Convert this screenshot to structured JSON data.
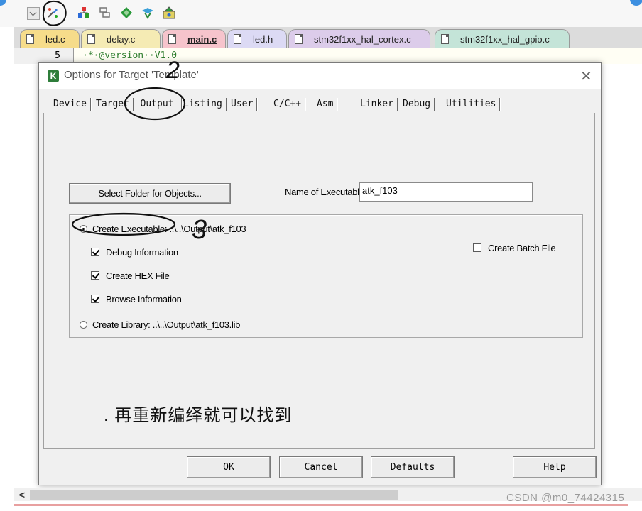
{
  "toolbar": {
    "icons": [
      "dropdown-arrow-icon",
      "options-for-target-icon",
      "manage-components-icon",
      "file-extensions-icon",
      "pack-installer-icon",
      "select-device-icon",
      "manage-packs-icon"
    ]
  },
  "editor_tabs": [
    {
      "label": "led.c",
      "color": "#f6dc8a"
    },
    {
      "label": "delay.c",
      "color": "#f5ebb4"
    },
    {
      "label": "main.c",
      "color": "#f6c4cc",
      "active": true
    },
    {
      "label": "led.h",
      "color": "#dcdaf4"
    },
    {
      "label": "stm32f1xx_hal_cortex.c",
      "color": "#dcccea"
    },
    {
      "label": "stm32f1xx_hal_gpio.c",
      "color": "#c4e4d8"
    }
  ],
  "code": {
    "line_number": "5",
    "text": "·*·@version··V1.0"
  },
  "dialog": {
    "title": "Options for Target 'Template'",
    "tabs": [
      "Device",
      "Target",
      "Output",
      "Listing",
      "User",
      "C/C++",
      "Asm",
      "Linker",
      "Debug",
      "Utilities"
    ],
    "active_tab": "Output",
    "select_folder_label": "Select Folder for Objects...",
    "name_of_executable_label": "Name of Executable:",
    "name_of_executable_value": "atk_f103",
    "create_executable_label": "Create Executable:  ..\\..\\Output\\atk_f103",
    "debug_information_label": "Debug Information",
    "create_hex_file_label": "Create HEX File",
    "browse_information_label": "Browse Information",
    "create_batch_file_label": "Create Batch File",
    "create_library_label": "Create Library:  ..\\..\\Output\\atk_f103.lib",
    "options": {
      "create_executable_selected": true,
      "debug_information_checked": true,
      "create_hex_file_checked": true,
      "browse_information_checked": true,
      "create_batch_file_checked": false,
      "create_library_selected": false
    },
    "ok_label": "OK",
    "cancel_label": "Cancel",
    "defaults_label": "Defaults",
    "help_label": "Help"
  },
  "annotations": {
    "note": ". 再重新编绎就可以找到",
    "step2": "2",
    "step3": "3"
  },
  "watermark": "CSDN @m0_74424315"
}
